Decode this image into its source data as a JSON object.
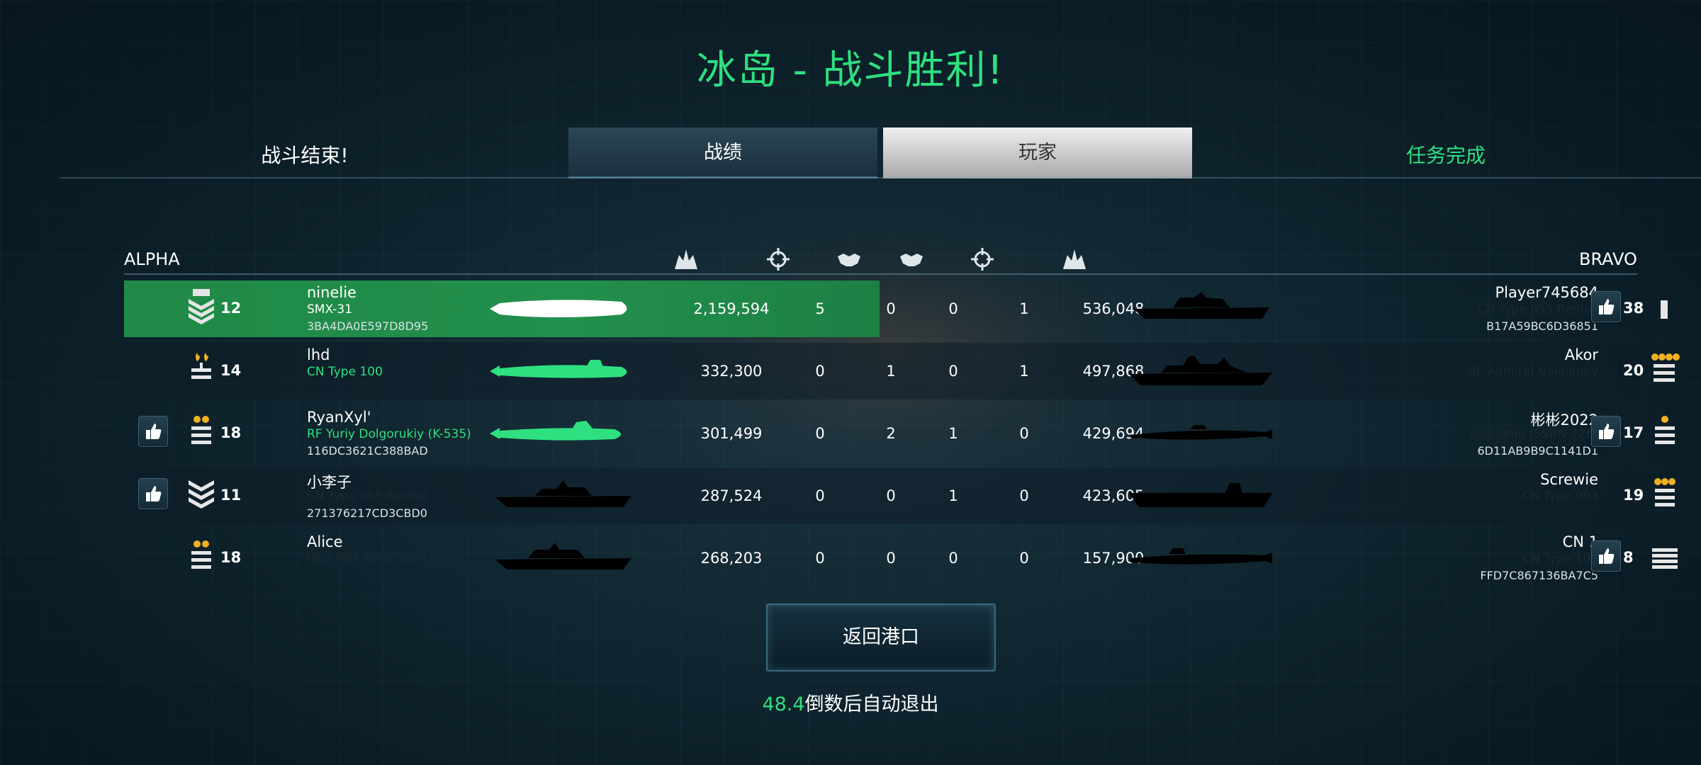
{
  "title": "冰岛 - 战斗胜利!",
  "battle_over": "战斗结束!",
  "tabs": [
    {
      "label": "战绩",
      "state": "selected"
    },
    {
      "label": "玩家",
      "state": "unselected"
    }
  ],
  "mission_complete": "任务完成",
  "teams": {
    "left": "ALPHA",
    "right": "BRAVO"
  },
  "column_icons": [
    "damage-icon",
    "target-icon",
    "assist-icon",
    "assist-icon",
    "target-icon",
    "damage-icon"
  ],
  "colors": {
    "accent": "#2ee080",
    "highlight_row": "#238f4c"
  },
  "alpha": [
    {
      "name": "ninelie",
      "ship": "SMX-31",
      "id": "3BA4DA0E597D8D95",
      "level": "12",
      "rank": "chevron-rank-icon",
      "damage": "2,159,594",
      "kills": "5",
      "assists": "0",
      "liked": false
    },
    {
      "name": "lhd",
      "ship": "CN Type 100",
      "id": "",
      "level": "14",
      "rank": "flame-rank-icon",
      "damage": "332,300",
      "kills": "0",
      "assists": "1",
      "liked": false
    },
    {
      "name": "RyanXyl'",
      "ship": "RF Yuriy Dolgorukiy (K-535)",
      "id": "116DC3621C388BAD",
      "level": "18",
      "rank": "two-medal-rank-icon",
      "damage": "301,499",
      "kills": "0",
      "assists": "2",
      "liked": true
    },
    {
      "name": "小李子",
      "ship": "CN Type 055 Renhai",
      "id": "271376217CD3CBD0",
      "level": "11",
      "rank": "chevron-rank-icon",
      "damage": "287,524",
      "kills": "0",
      "assists": "0",
      "liked": true
    },
    {
      "name": "Alice",
      "ship": "USS Port Royal (CG-73)",
      "id": "",
      "level": "18",
      "rank": "two-medal-rank-icon",
      "damage": "268,203",
      "kills": "0",
      "assists": "0",
      "liked": false
    }
  ],
  "bravo": [
    {
      "name": "Player745684",
      "ship": "CN Type 055 Renhai",
      "id": "B17A59BC6D36851",
      "level": "38",
      "rank": "bar-rank-icon",
      "damage": "536,048",
      "kills": "1",
      "assists": "0",
      "liked": true
    },
    {
      "name": "Akor",
      "ship": "RF Admiral Nakhimov",
      "id": "",
      "level": "20",
      "rank": "four-medal-rank-icon",
      "damage": "497,868",
      "kills": "1",
      "assists": "0",
      "liked": false
    },
    {
      "name": "彬彬2022",
      "ship": "USS Ohio (SSBN-726)",
      "id": "6D11AB9B9C1141D1",
      "level": "17",
      "rank": "one-medal-rank-icon",
      "damage": "429,694",
      "kills": "0",
      "assists": "1",
      "liked": true
    },
    {
      "name": "Screwie",
      "ship": "CN Type 003",
      "id": "",
      "level": "19",
      "rank": "three-medal-rank-icon",
      "damage": "423,605",
      "kills": "0",
      "assists": "1",
      "liked": false
    },
    {
      "name": "CN 1",
      "ship": "CN Type 100",
      "id": "FFD7C867136BA7C5",
      "level": "8",
      "rank": "stripes-rank-icon",
      "damage": "157,900",
      "kills": "0",
      "assists": "0",
      "liked": true
    }
  ],
  "return_button": "返回港口",
  "countdown": {
    "value": "48.4",
    "text": "倒数后自动退出"
  }
}
